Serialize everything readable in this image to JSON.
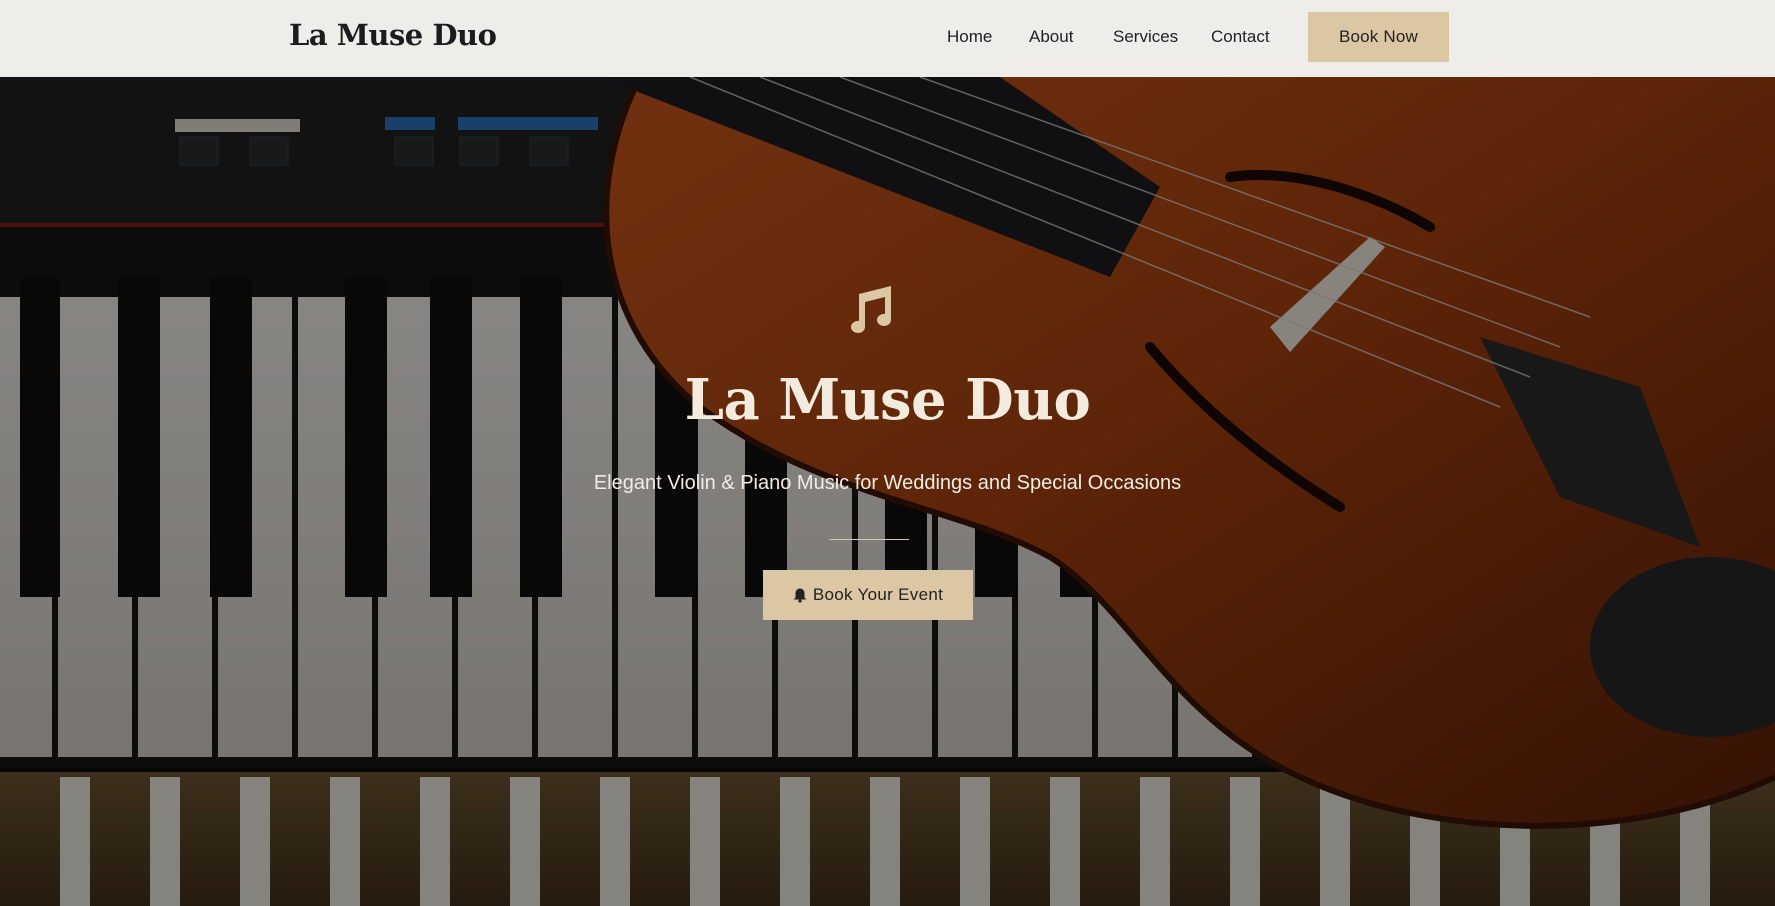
{
  "brand": {
    "name": "La Muse Duo"
  },
  "nav": {
    "items": [
      {
        "label": "Home"
      },
      {
        "label": "About"
      },
      {
        "label": "Services"
      },
      {
        "label": "Contact"
      }
    ],
    "cta_label": "Book Now"
  },
  "hero": {
    "icon": "music-note-icon",
    "title": "La Muse Duo",
    "subtitle": "Elegant Violin & Piano Music for Weddings and Special Occasions",
    "cta_icon": "bell-icon",
    "cta_label": "Book Your Event"
  },
  "colors": {
    "header_bg": "#efede9",
    "accent": "#dcc7a5",
    "hero_text": "#f4ebdf"
  }
}
